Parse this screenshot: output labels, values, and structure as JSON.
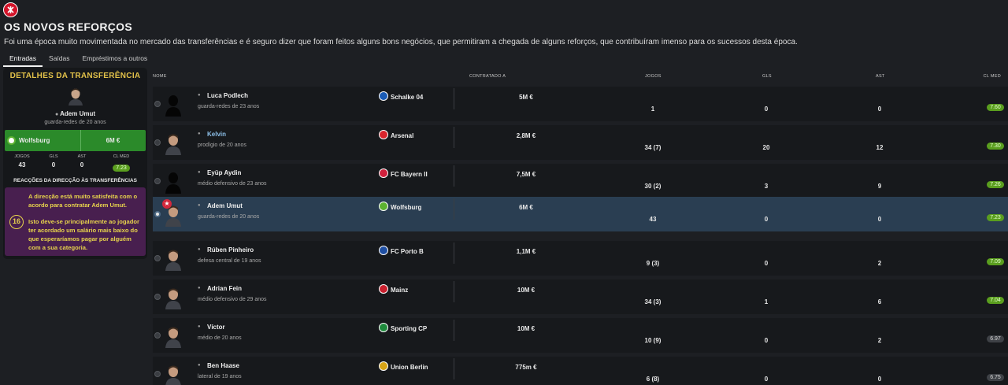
{
  "header": {
    "title": "OS NOVOS REFORÇOS",
    "subtitle": "Foi uma época muito movimentada no mercado das transferências e é seguro dizer que foram feitos alguns bons negócios, que permitiram a chegada de alguns reforços, que contribuíram imenso para os sucessos desta época."
  },
  "tabs": [
    {
      "label": "Entradas",
      "active": true
    },
    {
      "label": "Saídas",
      "active": false
    },
    {
      "label": "Empréstimos a outros",
      "active": false
    }
  ],
  "panel": {
    "title": "DETALHES DA TRANSFERÊNCIA",
    "player_name": "Adem Umut",
    "player_desc": "guarda-redes de 20 anos",
    "club": "Wolfsburg",
    "fee": "6M €",
    "stats": [
      {
        "label": "JOGOS",
        "value": "43"
      },
      {
        "label": "GLS",
        "value": "0"
      },
      {
        "label": "AST",
        "value": "0"
      },
      {
        "label": "CL MED",
        "value": "7.23"
      }
    ],
    "reactions_title": "REACÇÕES DA DIRECÇÃO ÀS TRANSFERÊNCIAS",
    "reaction_text1": "A direcção está muito satisfeita com o acordo para contratar Adem Umut.",
    "reaction_text2": "Isto deve-se principalmente ao jogador ter acordado um salário mais baixo do que esperaríamos pagar por alguém com a sua categoria.",
    "reaction_number": "16"
  },
  "table": {
    "columns": [
      "NOME",
      "CONTRATADO A",
      "JOGOS",
      "GLS",
      "AST",
      "CL MED"
    ],
    "rows": [
      {
        "name": "Luca Podlech",
        "desc": "guarda-redes de 23 anos",
        "club": "Schalke 04",
        "club_color": "#1a5bb5",
        "fee": "5M €",
        "jogos": "1",
        "gls": "0",
        "ast": "0",
        "rating": "7.60",
        "rating_style": "green",
        "link": false,
        "selected": false,
        "star": false,
        "face": "silhouette"
      },
      {
        "name": "Kelvin",
        "desc": "prodígio de 20 anos",
        "club": "Arsenal",
        "club_color": "#d9242c",
        "fee": "2,8M €",
        "jogos": "34 (7)",
        "gls": "20",
        "ast": "12",
        "rating": "7.30",
        "rating_style": "green",
        "link": true,
        "selected": false,
        "star": false,
        "face": "face"
      },
      {
        "name": "Eyüp Aydin",
        "desc": "médio defensivo de 23 anos",
        "club": "FC Bayern II",
        "club_color": "#d0203c",
        "fee": "7,5M €",
        "jogos": "30 (2)",
        "gls": "3",
        "ast": "9",
        "rating": "7.26",
        "rating_style": "green",
        "link": false,
        "selected": false,
        "star": false,
        "face": "silhouette"
      },
      {
        "name": "Adem Umut",
        "desc": "guarda-redes de 20 anos",
        "club": "Wolfsburg",
        "club_color": "#5cb130",
        "fee": "6M €",
        "jogos": "43",
        "gls": "0",
        "ast": "0",
        "rating": "7.23",
        "rating_style": "green",
        "link": false,
        "selected": true,
        "star": true,
        "face": "face"
      },
      {
        "name": "Rúben Pinheiro",
        "desc": "defesa central de 19 anos",
        "club": "FC Porto B",
        "club_color": "#1f4fa3",
        "fee": "1,1M €",
        "jogos": "9 (3)",
        "gls": "0",
        "ast": "2",
        "rating": "7.09",
        "rating_style": "green",
        "link": false,
        "selected": false,
        "star": false,
        "face": "face"
      },
      {
        "name": "Adrian Fein",
        "desc": "médio defensivo de 29 anos",
        "club": "Mainz",
        "club_color": "#c9202e",
        "fee": "10M €",
        "jogos": "34 (3)",
        "gls": "1",
        "ast": "6",
        "rating": "7.04",
        "rating_style": "green",
        "link": false,
        "selected": false,
        "star": false,
        "face": "face"
      },
      {
        "name": "Víctor",
        "desc": "médio de 20 anos",
        "club": "Sporting CP",
        "club_color": "#1e8a3c",
        "fee": "10M €",
        "jogos": "10 (9)",
        "gls": "0",
        "ast": "2",
        "rating": "6.97",
        "rating_style": "grey",
        "link": false,
        "selected": false,
        "star": false,
        "face": "face"
      },
      {
        "name": "Ben Haase",
        "desc": "lateral de 19 anos",
        "club": "Union Berlin",
        "club_color": "#d7a416",
        "fee": "775m €",
        "jogos": "6 (8)",
        "gls": "0",
        "ast": "0",
        "rating": "6.75",
        "rating_style": "grey",
        "link": false,
        "selected": false,
        "star": false,
        "face": "face"
      }
    ]
  }
}
